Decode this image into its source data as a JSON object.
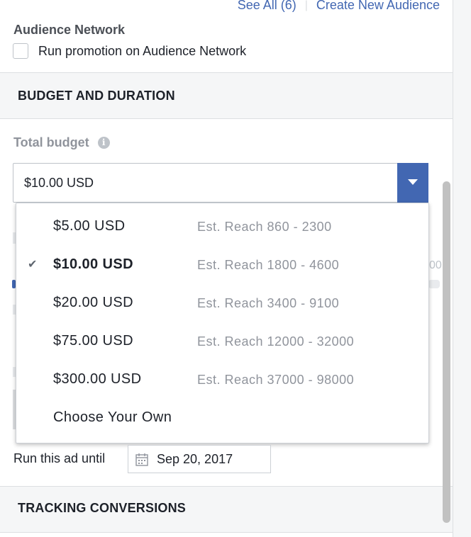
{
  "top_links": {
    "see_all": "See All (6)",
    "create_audience": "Create New Audience"
  },
  "audience_network": {
    "section_label": "Audience Network",
    "checkbox_label": "Run promotion on Audience Network",
    "checked": false
  },
  "budget_section": {
    "title": "BUDGET AND DURATION"
  },
  "total_budget": {
    "label": "Total budget",
    "info_icon": "i",
    "selected_value": "$10.00 USD",
    "options": [
      {
        "amount": "$5.00 USD",
        "reach": "Est. Reach 860 - 2300",
        "selected": false
      },
      {
        "amount": "$10.00 USD",
        "reach": "Est. Reach 1800 - 4600",
        "selected": true,
        "check": "✔"
      },
      {
        "amount": "$20.00 USD",
        "reach": "Est. Reach 3400 - 9100",
        "selected": false
      },
      {
        "amount": "$75.00 USD",
        "reach": "Est. Reach 12000 - 32000",
        "selected": false
      },
      {
        "amount": "$300.00 USD",
        "reach": "Est. Reach 37000 - 98000",
        "selected": false
      },
      {
        "amount": "Choose Your Own",
        "reach": "",
        "selected": false
      }
    ]
  },
  "duration": {
    "label": "Run this ad until",
    "date": "Sep 20, 2017"
  },
  "tracking_section": {
    "title": "TRACKING CONVERSIONS"
  },
  "colors": {
    "accent": "#4267b2",
    "muted_text": "#90949c",
    "section_bg": "#f5f6f7",
    "border": "#dddfe2"
  }
}
